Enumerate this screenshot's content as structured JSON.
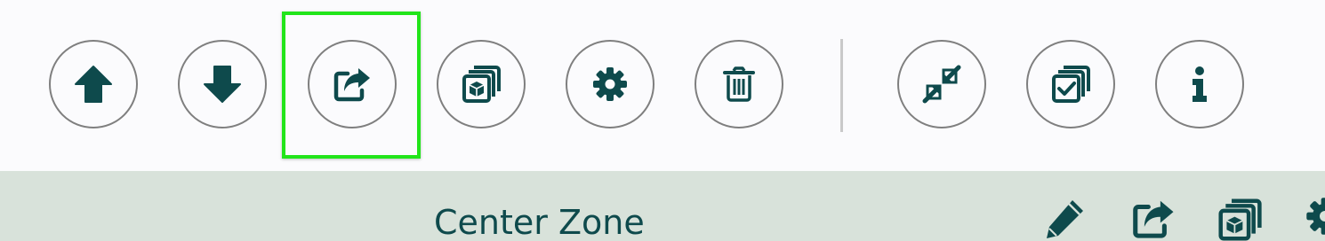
{
  "toolbar": {
    "buttons": [
      {
        "name": "move-up",
        "icon": "arrow-up-icon"
      },
      {
        "name": "move-down",
        "icon": "arrow-down-icon"
      },
      {
        "name": "share",
        "icon": "share-icon"
      },
      {
        "name": "duplicate",
        "icon": "copy-cube-icon"
      },
      {
        "name": "settings",
        "icon": "gear-icon"
      },
      {
        "name": "delete",
        "icon": "trash-icon"
      },
      {
        "name": "collapse",
        "icon": "compress-icon"
      },
      {
        "name": "select-copy",
        "icon": "copy-check-icon"
      },
      {
        "name": "info",
        "icon": "info-icon"
      }
    ],
    "highlighted_button": "share"
  },
  "zone": {
    "title": "Center Zone",
    "actions": [
      "pencil-icon",
      "share-icon",
      "copy-cube-icon",
      "gear-icon"
    ]
  },
  "colors": {
    "icon": "#0e4a4c",
    "button_border": "#7f7f7f",
    "highlight": "#22e51a",
    "zone_background": "#d8e2da",
    "toolbar_background": "#fbfbfd"
  }
}
